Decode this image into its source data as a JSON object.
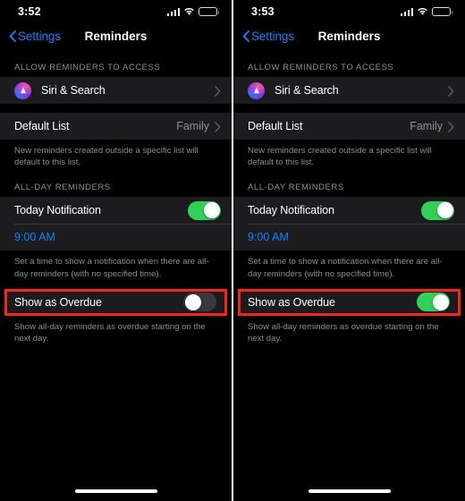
{
  "screens": [
    {
      "id": "before",
      "status": {
        "time": "3:52",
        "signal_icon": "cellular-signal-icon",
        "wifi_icon": "wifi-icon",
        "battery_icon": "battery-low-power-icon"
      },
      "nav": {
        "back_label": "Settings",
        "title": "Reminders"
      },
      "access_section": {
        "header": "ALLOW REMINDERS TO ACCESS",
        "item_label": "Siri & Search",
        "item_icon": "siri-icon"
      },
      "default_list": {
        "label": "Default List",
        "value": "Family",
        "footer": "New reminders created outside a specific list will default to this list."
      },
      "allday_section": {
        "header": "ALL-DAY REMINDERS",
        "today_notification_label": "Today Notification",
        "today_notification_on": true,
        "time_value": "9:00 AM",
        "footer": "Set a time to show a notification when there are all-day reminders (with no specified time)."
      },
      "overdue": {
        "label": "Show as Overdue",
        "enabled": false,
        "footer": "Show all-day reminders as overdue starting on the next day.",
        "highlight_color": "#ff2116"
      }
    },
    {
      "id": "after",
      "status": {
        "time": "3:53",
        "signal_icon": "cellular-signal-icon",
        "wifi_icon": "wifi-icon",
        "battery_icon": "battery-low-power-icon"
      },
      "nav": {
        "back_label": "Settings",
        "title": "Reminders"
      },
      "access_section": {
        "header": "ALLOW REMINDERS TO ACCESS",
        "item_label": "Siri & Search",
        "item_icon": "siri-icon"
      },
      "default_list": {
        "label": "Default List",
        "value": "Family",
        "footer": "New reminders created outside a specific list will default to this list."
      },
      "allday_section": {
        "header": "ALL-DAY REMINDERS",
        "today_notification_label": "Today Notification",
        "today_notification_on": true,
        "time_value": "9:00 AM",
        "footer": "Set a time to show a notification when there are all-day reminders (with no specified time)."
      },
      "overdue": {
        "label": "Show as Overdue",
        "enabled": true,
        "footer": "Show all-day reminders as overdue starting on the next day.",
        "highlight_color": "#ff2116"
      }
    }
  ],
  "colors": {
    "accent_blue": "#0a84ff",
    "toggle_on_green": "#30d158",
    "toggle_off_gray": "#39393d",
    "row_background": "#1c1c1e",
    "page_background": "#000000",
    "secondary_text": "#8e8e93",
    "battery_yellow": "#f5c518"
  }
}
